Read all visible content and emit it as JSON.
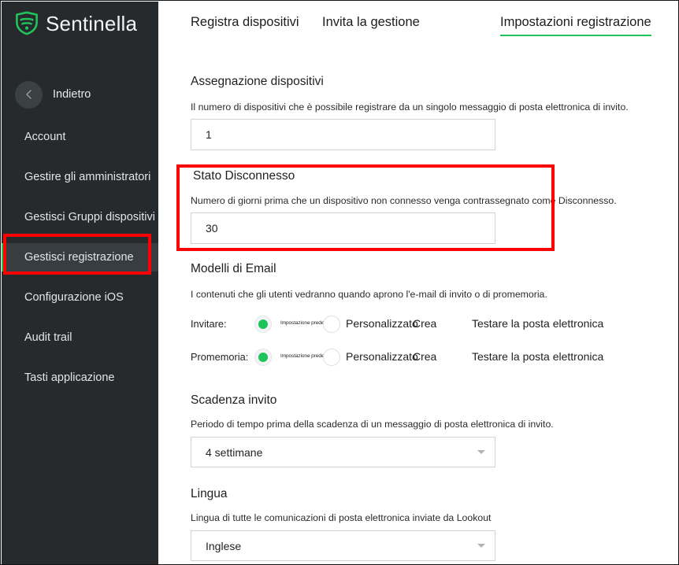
{
  "brand": {
    "name": "Sentinella",
    "logo_icon": "shield-waves-icon",
    "logo_color": "#21c45a"
  },
  "sidebar": {
    "back": {
      "label": "Indietro",
      "icon": "chevron-left-icon"
    },
    "items": [
      {
        "label": "Account",
        "active": false
      },
      {
        "label": "Gestire gli amministratori",
        "active": false
      },
      {
        "label": "Gestisci Gruppi dispositivi",
        "active": false
      },
      {
        "label": "Gestisci registrazione",
        "active": true
      },
      {
        "label": "Configurazione iOS",
        "active": false
      },
      {
        "label": "Audit trail",
        "active": false
      },
      {
        "label": "Tasti applicazione",
        "active": false
      }
    ],
    "accent_color": "#1ec35a"
  },
  "tabs": [
    {
      "label": "Registra dispositivi",
      "active": false
    },
    {
      "label": "Invita la gestione",
      "active": false
    },
    {
      "label": "Impostazioni registrazione",
      "active": true
    }
  ],
  "sections": {
    "device_assignment": {
      "title": "Assegnazione dispositivi",
      "description": "Il numero di dispositivi che è possibile registrare da un singolo messaggio di posta elettronica di invito.",
      "value": "1"
    },
    "disconnected_state": {
      "title": "Stato Disconnesso",
      "description": "Numero di giorni prima che un dispositivo non connesso venga contrassegnato come Disconnesso.",
      "value": "30"
    },
    "email_templates": {
      "title": "Modelli di Email",
      "description": "I contenuti che gli utenti vedranno quando aprono l'e-mail di invito o di promemoria.",
      "rows": [
        {
          "label": "Invitare:",
          "default_label": "Impostazione predefinita",
          "default_selected": true,
          "custom_label": "Personalizzato",
          "create_label": "Crea",
          "test_label": "Testare la posta elettronica"
        },
        {
          "label": "Promemoria:",
          "default_label": "Impostazione predefinita",
          "default_selected": true,
          "custom_label": "Personalizzato",
          "create_label": "Crea",
          "test_label": "Testare la posta elettronica"
        }
      ]
    },
    "invite_expiration": {
      "title": "Scadenza invito",
      "description": "Periodo di tempo prima della scadenza di un messaggio di posta elettronica di invito.",
      "value": "4 settimane",
      "caret_icon": "chevron-down-icon"
    },
    "language": {
      "title": "Lingua",
      "description": "Lingua di tutte le comunicazioni di posta elettronica inviate da Lookout",
      "value": "Inglese",
      "caret_icon": "chevron-down-icon"
    }
  },
  "annotations": {
    "color": "#ff0000",
    "boxes": [
      {
        "name": "highlight-disconnected-state"
      },
      {
        "name": "highlight-sidebar-manage-enrollment"
      }
    ]
  }
}
